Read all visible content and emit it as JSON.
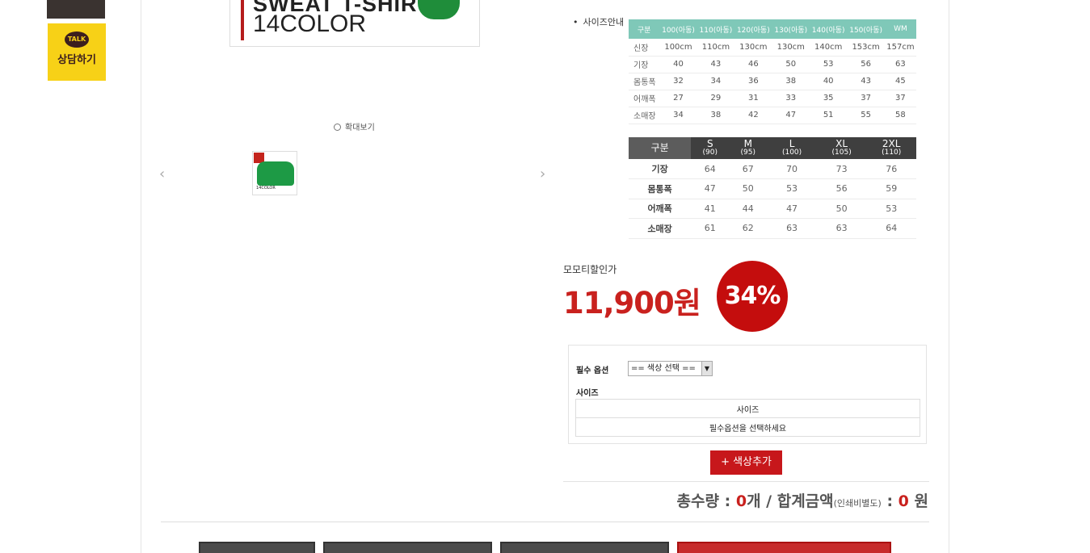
{
  "sidebar": {
    "kakao_badge": "TALK",
    "kakao_label": "상담하기"
  },
  "product_image": {
    "line1": "SWEAT T-SHIRT",
    "line2": "14COLOR"
  },
  "zoom_label": "확대보기",
  "size_guide": {
    "label": "사이즈안내",
    "kids_table": {
      "headers": [
        "구분",
        "100(아동)",
        "110(아동)",
        "120(아동)",
        "130(아동)",
        "140(아동)",
        "150(아동)",
        "WM"
      ],
      "rows": [
        [
          "신장",
          "100cm",
          "110cm",
          "130cm",
          "130cm",
          "140cm",
          "153cm",
          "157cm"
        ],
        [
          "기장",
          "40",
          "43",
          "46",
          "50",
          "53",
          "56",
          "63"
        ],
        [
          "몸통폭",
          "32",
          "34",
          "36",
          "38",
          "40",
          "43",
          "45"
        ],
        [
          "어깨폭",
          "27",
          "29",
          "31",
          "33",
          "35",
          "37",
          "37"
        ],
        [
          "소매장",
          "34",
          "38",
          "42",
          "47",
          "51",
          "55",
          "58"
        ]
      ]
    },
    "adult_table": {
      "headers": [
        {
          "size": "구분",
          "sub": ""
        },
        {
          "size": "S",
          "sub": "(90)"
        },
        {
          "size": "M",
          "sub": "(95)"
        },
        {
          "size": "L",
          "sub": "(100)"
        },
        {
          "size": "XL",
          "sub": "(105)"
        },
        {
          "size": "2XL",
          "sub": "(110)"
        }
      ],
      "rows": [
        [
          "기장",
          "64",
          "67",
          "70",
          "73",
          "76"
        ],
        [
          "몸통폭",
          "47",
          "50",
          "53",
          "56",
          "59"
        ],
        [
          "어깨폭",
          "41",
          "44",
          "47",
          "50",
          "53"
        ],
        [
          "소매장",
          "61",
          "62",
          "63",
          "63",
          "64"
        ]
      ]
    }
  },
  "price": {
    "label": "모모티할인가",
    "value": "11,900원",
    "discount": "34%"
  },
  "options": {
    "required_label": "필수 옵션",
    "color_select": "== 색상 선택 ==",
    "size_label": "사이즈",
    "table_header": "사이즈",
    "table_placeholder": "필수옵션을 선택하세요"
  },
  "add_color_button": "+ 색상추가",
  "total": {
    "qty_label": "총수량 : ",
    "qty_value": "0",
    "qty_unit": "개 / 합계금액",
    "note": "(인쇄비별도)",
    "sep": " : ",
    "amount": "0",
    "unit": " 원"
  },
  "colors": {
    "accent_red": "#c9211e",
    "kakao_yellow": "#f7d117",
    "table_header_mint": "#7fc8b8"
  }
}
